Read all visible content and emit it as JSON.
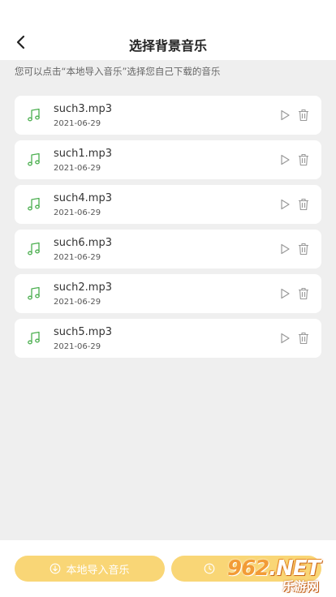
{
  "header": {
    "title": "选择背景音乐",
    "back_icon": "chevron-left-icon"
  },
  "hint": "您可以点击“本地导入音乐”选择您自己下载的音乐",
  "music_list": [
    {
      "name": "such3.mp3",
      "date": "2021-06-29"
    },
    {
      "name": "such1.mp3",
      "date": "2021-06-29"
    },
    {
      "name": "such4.mp3",
      "date": "2021-06-29"
    },
    {
      "name": "such6.mp3",
      "date": "2021-06-29"
    },
    {
      "name": "such2.mp3",
      "date": "2021-06-29"
    },
    {
      "name": "such5.mp3",
      "date": "2021-06-29"
    }
  ],
  "footer": {
    "import_label": "本地导入音乐",
    "import_icon": "download-circle-icon",
    "record_icon": "clock-icon"
  },
  "watermark": {
    "main": "962.NET",
    "sub": "乐游网"
  },
  "colors": {
    "accent": "#f9d676",
    "note_icon": "#4caf50",
    "background": "#efefef"
  }
}
